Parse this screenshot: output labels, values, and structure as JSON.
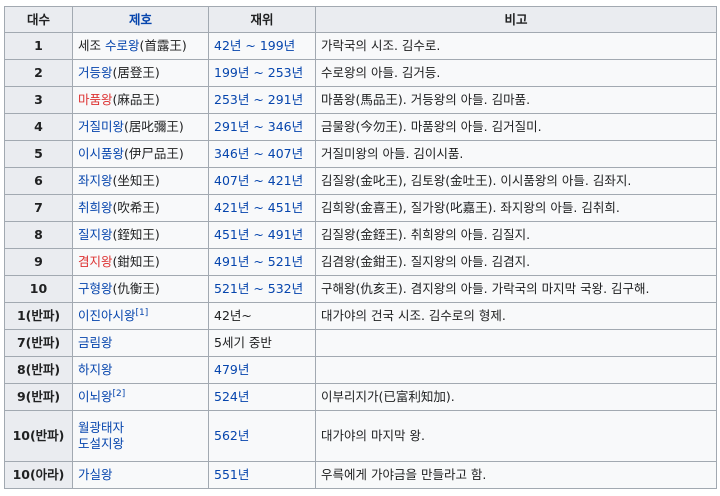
{
  "header": {
    "col_number": "대수",
    "col_title": "제호",
    "col_reign": "재위",
    "col_note": "비고"
  },
  "rows": [
    {
      "num": "1",
      "title": "세조 ",
      "title_link": "수로왕",
      "title_hanja": "(首露王)",
      "reign": "42년 ~ 199년",
      "note": "가락국의 시조. 김수로."
    },
    {
      "num": "2",
      "title_link": "거등왕",
      "title_hanja": "(居登王)",
      "reign": "199년 ~ 253년",
      "note": "수로왕의 아들. 김거등."
    },
    {
      "num": "3",
      "title_link": "마품왕",
      "title_hanja": "(麻品王)",
      "reign": "253년 ~ 291년",
      "note": "마품왕(馬品王). 거등왕의 아들. 김마품."
    },
    {
      "num": "4",
      "title_link": "거질미왕",
      "title_hanja": "(居叱彌王)",
      "reign": "291년 ~ 346년",
      "note": "금물왕(今勿王). 마품왕의 아들. 김거질미."
    },
    {
      "num": "5",
      "title_link": "이시품왕",
      "title_hanja": "(伊尸品王)",
      "reign": "346년 ~ 407년",
      "note": "거질미왕의 아들. 김이시품."
    },
    {
      "num": "6",
      "title_link": "좌지왕",
      "title_hanja": "(坐知王)",
      "reign": "407년 ~ 421년",
      "note": "김질왕(金叱王), 김토왕(金吐王). 이시품왕의 아들. 김좌지."
    },
    {
      "num": "7",
      "title_link": "취희왕",
      "title_hanja": "(吹希王)",
      "reign": "421년 ~ 451년",
      "note": "김희왕(金喜王), 질가왕(叱嘉王). 좌지왕의 아들. 김취희."
    },
    {
      "num": "8",
      "title_link": "질지왕",
      "title_hanja": "(銍知王)",
      "reign": "451년 ~ 491년",
      "note": "김질왕(金銍王). 취희왕의 아들. 김질지."
    },
    {
      "num": "9",
      "title_link": "겸지왕",
      "title_hanja": "(鉗知王)",
      "reign": "491년 ~ 521년",
      "note": "김겸왕(金鉗王). 질지왕의 아들. 김겸지."
    },
    {
      "num": "10",
      "title_link": "구형왕",
      "title_hanja": "(仇衡王)",
      "reign": "521년 ~ 532년",
      "note": "구해왕(仇亥王). 겸지왕의 아들. 가락국의 마지막 국왕. 김구해."
    },
    {
      "num": "1(반파)",
      "title_link": "이진아시왕",
      "title_sup": "[1]",
      "reign": "42년~",
      "note": "대가야의 건국 시조. 김수로의 형제."
    },
    {
      "num": "7(반파)",
      "title_link": "금림왕",
      "reign": "5세기 중반",
      "note": ""
    },
    {
      "num": "8(반파)",
      "title_link": "하지왕",
      "reign": "479년",
      "note": ""
    },
    {
      "num": "9(반파)",
      "title_link": "이뇌왕",
      "title_sup": "[2]",
      "reign": "524년",
      "note": "이부리지가(已富利知加)."
    },
    {
      "num": "10(반파)",
      "title_link": "월광태자",
      "title_link2": "도설지왕",
      "reign": "562년",
      "note": "대가야의 마지막 왕."
    },
    {
      "num": "10(아라)",
      "title_link": "가실왕",
      "reign": "551년",
      "note": "우륵에게 가야금을 만들라고 함."
    }
  ],
  "colors": {
    "link": "#0645ad",
    "redlink": "#d33",
    "header_bg": "#eaecf0",
    "border": "#a2a9b1",
    "cell_bg": "#f8f9fa"
  }
}
